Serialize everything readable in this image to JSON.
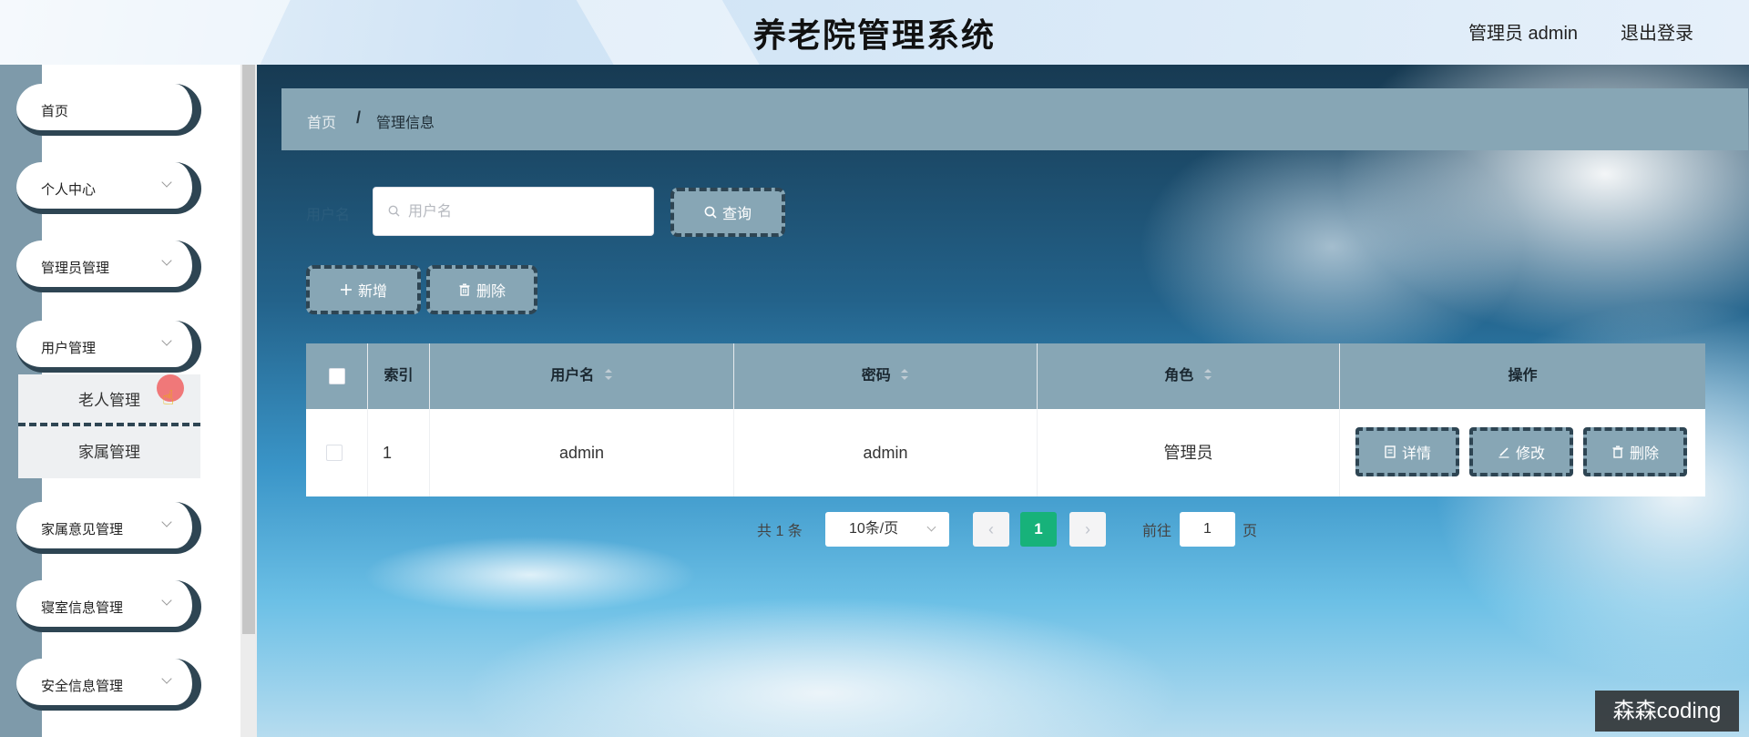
{
  "header": {
    "title": "养老院管理系统",
    "user_label": "管理员 admin",
    "logout_label": "退出登录"
  },
  "sidebar": {
    "items": [
      {
        "label": "首页",
        "has_arrow": false
      },
      {
        "label": "个人中心",
        "has_arrow": true
      },
      {
        "label": "管理员管理",
        "has_arrow": true
      },
      {
        "label": "用户管理",
        "has_arrow": true
      },
      {
        "label": "家属意见管理",
        "has_arrow": true
      },
      {
        "label": "寝室信息管理",
        "has_arrow": true
      },
      {
        "label": "安全信息管理",
        "has_arrow": true
      }
    ],
    "submenu": [
      {
        "label": "老人管理"
      },
      {
        "label": "家属管理"
      }
    ]
  },
  "breadcrumb": {
    "home": "首页",
    "separator": "/",
    "current": "管理信息"
  },
  "search": {
    "label": "用户名",
    "placeholder": "用户名",
    "value": "",
    "query_button": "查询"
  },
  "actions": {
    "add_button": "新增",
    "delete_button": "删除"
  },
  "table": {
    "columns": [
      "索引",
      "用户名",
      "密码",
      "角色",
      "操作"
    ],
    "rows": [
      {
        "index": "1",
        "username": "admin",
        "password": "admin",
        "role": "管理员",
        "buttons": [
          "详情",
          "修改",
          "删除"
        ]
      }
    ]
  },
  "pagination": {
    "total": "共 1 条",
    "page_size": "10条/页",
    "current_page": "1",
    "goto_label": "前往",
    "goto_value": "1",
    "page_suffix": "页"
  },
  "watermark": "森森coding",
  "colors": {
    "accent": "#87a6b5",
    "dark_border": "#2e4553",
    "active_page": "#17b27a"
  }
}
